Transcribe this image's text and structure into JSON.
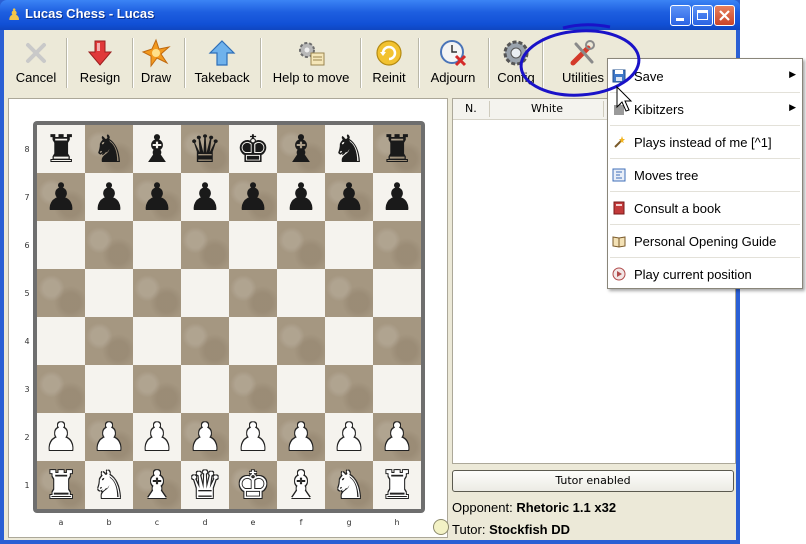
{
  "window": {
    "title": "Lucas Chess - Lucas"
  },
  "toolbar": {
    "cancel": "Cancel",
    "resign": "Resign",
    "draw": "Draw",
    "takeback": "Takeback",
    "help": "Help to move",
    "reinit": "Reinit",
    "adjourn": "Adjourn",
    "config": "Config",
    "utilities": "Utilities"
  },
  "board": {
    "ranks": [
      "8",
      "7",
      "6",
      "5",
      "4",
      "3",
      "2",
      "1"
    ],
    "files": [
      "a",
      "b",
      "c",
      "d",
      "e",
      "f",
      "g",
      "h"
    ],
    "rows": [
      [
        "♜",
        "♞",
        "♝",
        "♛",
        "♚",
        "♝",
        "♞",
        "♜"
      ],
      [
        "♟",
        "♟",
        "♟",
        "♟",
        "♟",
        "♟",
        "♟",
        "♟"
      ],
      [
        "",
        "",
        "",
        "",
        "",
        "",
        "",
        ""
      ],
      [
        "",
        "",
        "",
        "",
        "",
        "",
        "",
        ""
      ],
      [
        "",
        "",
        "",
        "",
        "",
        "",
        "",
        ""
      ],
      [
        "",
        "",
        "",
        "",
        "",
        "",
        "",
        ""
      ],
      [
        "♟",
        "♟",
        "♟",
        "♟",
        "♟",
        "♟",
        "♟",
        "♟"
      ],
      [
        "♜",
        "♞",
        "♝",
        "♛",
        "♚",
        "♝",
        "♞",
        "♜"
      ]
    ]
  },
  "moves": {
    "col_n": "N.",
    "col_white": "White"
  },
  "tutor_button": "Tutor enabled",
  "opponent": {
    "label": "Opponent:",
    "value": "Rhetoric 1.1 x32"
  },
  "tutor": {
    "label": "Tutor:",
    "value": "Stockfish DD"
  },
  "menu": {
    "items": [
      {
        "label": "Save",
        "icon": "floppy-icon",
        "submenu": true
      },
      {
        "label": "Kibitzers",
        "icon": "puzzle-icon",
        "submenu": true
      },
      {
        "label": "Plays instead of me  [^1]",
        "icon": "wand-icon",
        "submenu": false
      },
      {
        "label": "Moves tree",
        "icon": "tree-icon",
        "submenu": false
      },
      {
        "label": "Consult a book",
        "icon": "book-icon",
        "submenu": false
      },
      {
        "label": "Personal Opening Guide",
        "icon": "open-book-icon",
        "submenu": false
      },
      {
        "label": "Play current position",
        "icon": "play-icon",
        "submenu": false
      }
    ]
  },
  "colors": {
    "annotation": "#1a12c8",
    "title_bar": "#1e5fe0",
    "dark_square": "#a59781",
    "light_square": "#f5f3ee"
  }
}
